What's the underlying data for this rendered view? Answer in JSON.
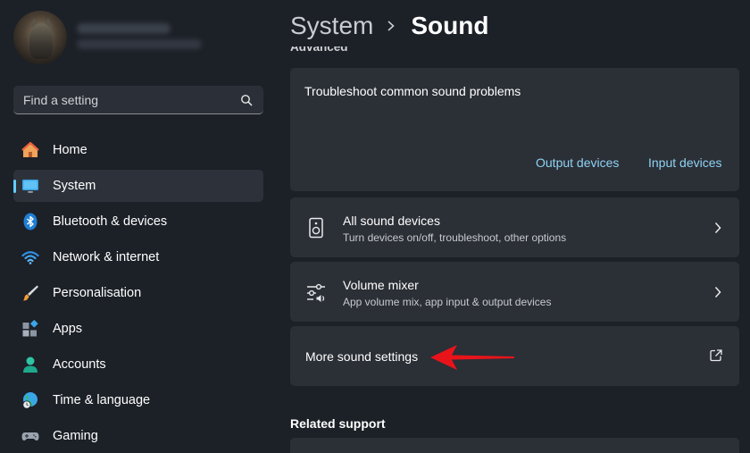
{
  "search": {
    "placeholder": "Find a setting"
  },
  "nav": {
    "items": [
      {
        "label": "Home",
        "icon": "home-icon"
      },
      {
        "label": "System",
        "icon": "monitor-icon",
        "active": true
      },
      {
        "label": "Bluetooth & devices",
        "icon": "bluetooth-icon"
      },
      {
        "label": "Network & internet",
        "icon": "wifi-icon"
      },
      {
        "label": "Personalisation",
        "icon": "brush-icon"
      },
      {
        "label": "Apps",
        "icon": "apps-icon"
      },
      {
        "label": "Accounts",
        "icon": "person-icon"
      },
      {
        "label": "Time & language",
        "icon": "globe-clock-icon"
      },
      {
        "label": "Gaming",
        "icon": "gamepad-icon"
      }
    ]
  },
  "breadcrumb": {
    "parent": "System",
    "current": "Sound"
  },
  "section_peek": "Advanced",
  "troubleshoot": {
    "title": "Troubleshoot common sound problems",
    "output_link": "Output devices",
    "input_link": "Input devices"
  },
  "rows": {
    "all_devices": {
      "title": "All sound devices",
      "subtitle": "Turn devices on/off, troubleshoot, other options"
    },
    "volume_mixer": {
      "title": "Volume mixer",
      "subtitle": "App volume mix, app input & output devices"
    },
    "more_settings": {
      "title": "More sound settings"
    }
  },
  "related_support": "Related support",
  "colors": {
    "accent": "#60cdff",
    "link": "#8fd3f4",
    "annotation_arrow": "#e8141a"
  }
}
